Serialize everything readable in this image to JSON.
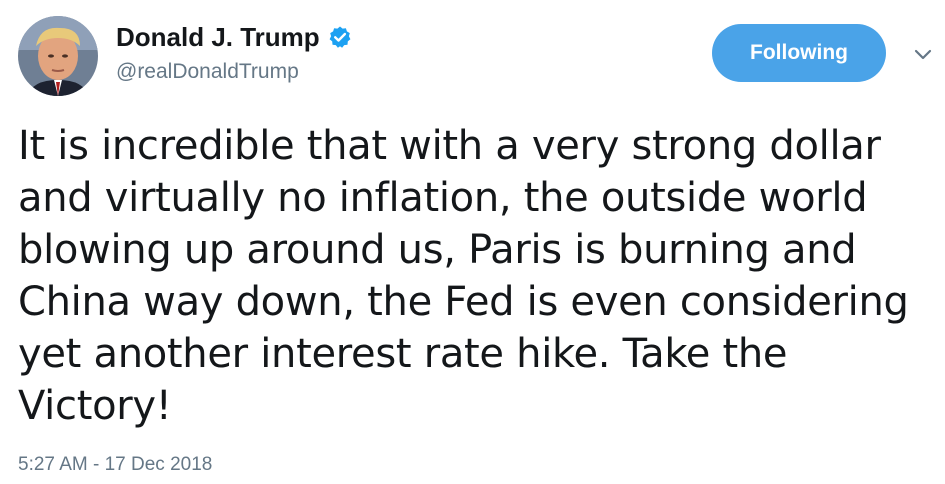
{
  "author": {
    "display_name": "Donald J. Trump",
    "handle": "@realDonaldTrump",
    "verified_icon": "verified-badge-icon",
    "avatar_icon": "profile-photo"
  },
  "follow_button": {
    "label": "Following",
    "color": "#4aa3e8"
  },
  "menu_caret_icon": "chevron-down-icon",
  "tweet": {
    "lines": [
      "It is incredible that with a very strong dollar",
      "and virtually no inflation, the outside world",
      "blowing up around us, Paris is burning and",
      "China way down, the Fed is even considering",
      "yet another interest rate hike. Take the",
      "Victory!"
    ],
    "timestamp": "5:27 AM - 17 Dec 2018"
  },
  "colors": {
    "text": "#14171a",
    "secondary_text": "#657786",
    "verified": "#1da1f2"
  }
}
